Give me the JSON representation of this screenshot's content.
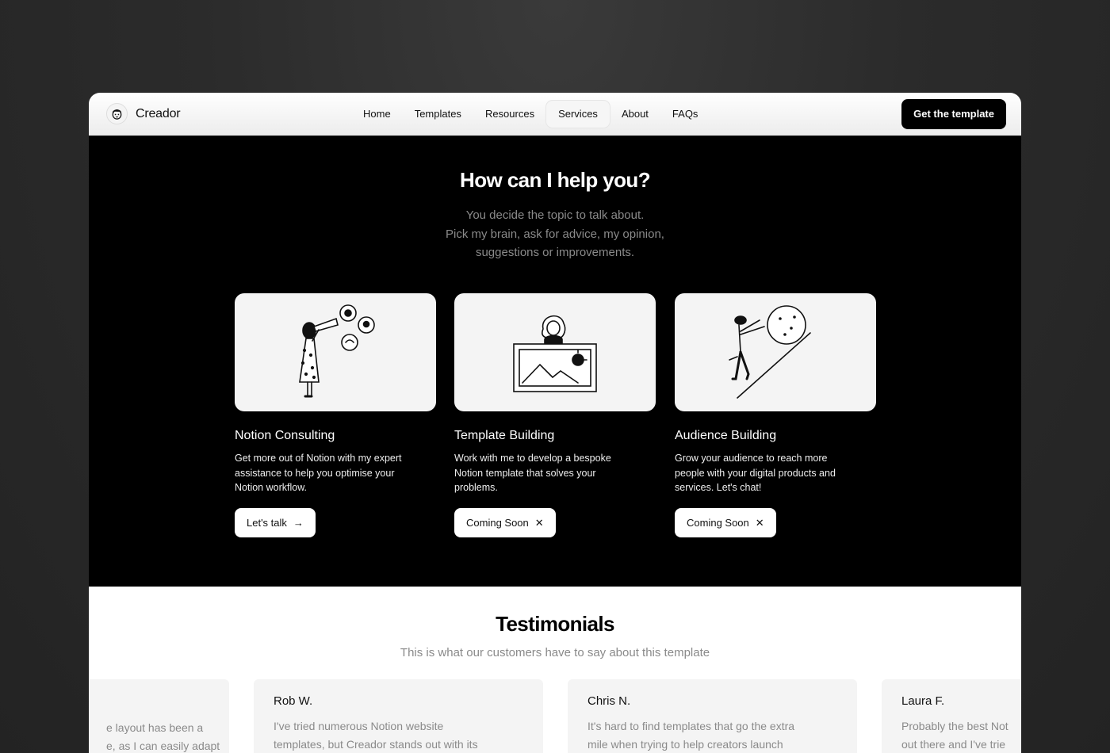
{
  "nav": {
    "brand": "Creador",
    "items": [
      "Home",
      "Templates",
      "Resources",
      "Services",
      "About",
      "FAQs"
    ],
    "active": "Services",
    "cta": "Get the template"
  },
  "services": {
    "title": "How can I help you?",
    "subtitle_lines": [
      "You decide the topic to talk about.",
      "Pick my brain, ask for advice, my opinion,",
      "suggestions or improvements."
    ],
    "cards": [
      {
        "title": "Notion Consulting",
        "desc_lines": [
          "Get more out of Notion with my expert",
          "assistance to help you optimise your",
          "Notion workflow."
        ],
        "button": "Let's talk",
        "button_icon": "arrow-right-icon"
      },
      {
        "title": "Template Building",
        "desc_lines": [
          "Work with me to develop a bespoke",
          "Notion template that solves your",
          "problems."
        ],
        "button": "Coming Soon",
        "button_icon": "close-icon"
      },
      {
        "title": "Audience Building",
        "desc_lines": [
          "Grow your audience to reach more",
          "people with your digital products and",
          "services. Let's chat!"
        ],
        "button": "Coming Soon",
        "button_icon": "close-icon"
      }
    ]
  },
  "testimonials": {
    "title": "Testimonials",
    "subtitle": "This is what our customers have to say about this template",
    "items": [
      {
        "name": "",
        "quote_lines": [
          "e layout has been a",
          "e, as I can easily adapt"
        ]
      },
      {
        "name": "Rob W.",
        "quote_lines": [
          "I've tried numerous Notion website",
          "templates, but Creador stands out with its"
        ]
      },
      {
        "name": "Chris N.",
        "quote_lines": [
          "It's hard to find templates that go the extra",
          "mile when trying to help creators launch"
        ]
      },
      {
        "name": "Laura F.",
        "quote_lines": [
          "Probably the best Not",
          "out there and I've trie"
        ]
      }
    ]
  },
  "colors": {
    "dark": "#000000",
    "light_card": "#f4f4f4",
    "muted_text": "#8a8a8a"
  }
}
